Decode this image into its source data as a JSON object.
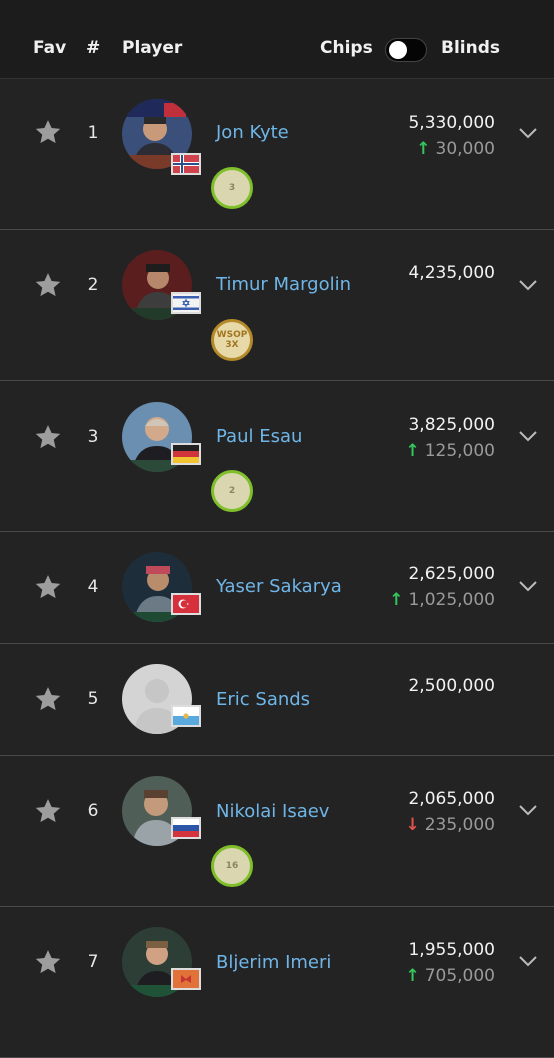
{
  "header": {
    "fav": "Fav",
    "num": "#",
    "player": "Player",
    "chips": "Chips",
    "blinds": "Blinds"
  },
  "players": [
    {
      "rank": "1",
      "name": "Jon Kyte",
      "chips": "5,330,000",
      "change": "30,000",
      "dir": "up",
      "badge": "3",
      "badge_style": "green"
    },
    {
      "rank": "2",
      "name": "Timur Margolin",
      "chips": "4,235,000",
      "change": "",
      "dir": "",
      "badge": "WSOP 3X",
      "badge_style": "gold"
    },
    {
      "rank": "3",
      "name": "Paul Esau",
      "chips": "3,825,000",
      "change": "125,000",
      "dir": "up",
      "badge": "2",
      "badge_style": "green"
    },
    {
      "rank": "4",
      "name": "Yaser Sakarya",
      "chips": "2,625,000",
      "change": "1,025,000",
      "dir": "up",
      "badge": "",
      "badge_style": ""
    },
    {
      "rank": "5",
      "name": "Eric Sands",
      "chips": "2,500,000",
      "change": "",
      "dir": "",
      "badge": "",
      "badge_style": ""
    },
    {
      "rank": "6",
      "name": "Nikolai Isaev",
      "chips": "2,065,000",
      "change": "235,000",
      "dir": "down",
      "badge": "16",
      "badge_style": "green"
    },
    {
      "rank": "7",
      "name": "Bljerim Imeri",
      "chips": "1,955,000",
      "change": "705,000",
      "dir": "up",
      "badge": "",
      "badge_style": ""
    }
  ],
  "icons": {
    "star": "star-icon",
    "chevron": "chevron-down-icon",
    "up": "arrow-up-icon",
    "down": "arrow-down-icon"
  },
  "colors": {
    "name_link": "#6fb6e8",
    "up": "#34c55c",
    "down": "#e0524c",
    "badge_green": "#7fbf2a"
  }
}
